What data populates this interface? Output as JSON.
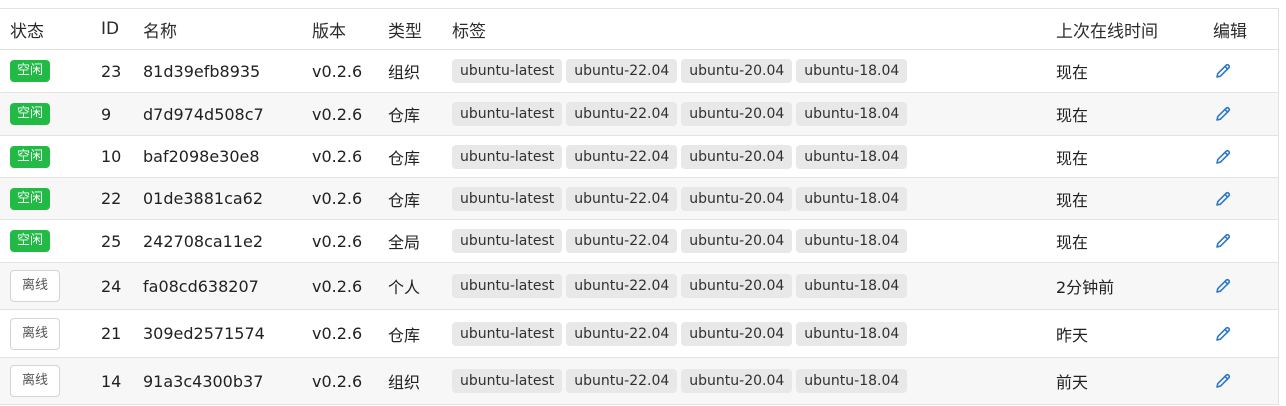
{
  "headers": {
    "status": "状态",
    "id": "ID",
    "name": "名称",
    "version": "版本",
    "type": "类型",
    "tags": "标签",
    "last_online": "上次在线时间",
    "edit": "编辑"
  },
  "colors": {
    "idle_badge": "#21ba45",
    "edit_icon": "#2f78c4"
  },
  "rows": [
    {
      "status": "空闲",
      "status_kind": "idle",
      "id": "23",
      "name": "81d39efb8935",
      "version": "v0.2.6",
      "type": "组织",
      "tags": [
        "ubuntu-latest",
        "ubuntu-22.04",
        "ubuntu-20.04",
        "ubuntu-18.04"
      ],
      "last_online": "现在",
      "edit_icon": "pencil-icon"
    },
    {
      "status": "空闲",
      "status_kind": "idle",
      "id": "9",
      "name": "d7d974d508c7",
      "version": "v0.2.6",
      "type": "仓库",
      "tags": [
        "ubuntu-latest",
        "ubuntu-22.04",
        "ubuntu-20.04",
        "ubuntu-18.04"
      ],
      "last_online": "现在",
      "edit_icon": "pencil-icon"
    },
    {
      "status": "空闲",
      "status_kind": "idle",
      "id": "10",
      "name": "baf2098e30e8",
      "version": "v0.2.6",
      "type": "仓库",
      "tags": [
        "ubuntu-latest",
        "ubuntu-22.04",
        "ubuntu-20.04",
        "ubuntu-18.04"
      ],
      "last_online": "现在",
      "edit_icon": "pencil-icon"
    },
    {
      "status": "空闲",
      "status_kind": "idle",
      "id": "22",
      "name": "01de3881ca62",
      "version": "v0.2.6",
      "type": "仓库",
      "tags": [
        "ubuntu-latest",
        "ubuntu-22.04",
        "ubuntu-20.04",
        "ubuntu-18.04"
      ],
      "last_online": "现在",
      "edit_icon": "pencil-icon"
    },
    {
      "status": "空闲",
      "status_kind": "idle",
      "id": "25",
      "name": "242708ca11e2",
      "version": "v0.2.6",
      "type": "全局",
      "tags": [
        "ubuntu-latest",
        "ubuntu-22.04",
        "ubuntu-20.04",
        "ubuntu-18.04"
      ],
      "last_online": "现在",
      "edit_icon": "pencil-icon"
    },
    {
      "status": "离线",
      "status_kind": "offline",
      "id": "24",
      "name": "fa08cd638207",
      "version": "v0.2.6",
      "type": "个人",
      "tags": [
        "ubuntu-latest",
        "ubuntu-22.04",
        "ubuntu-20.04",
        "ubuntu-18.04"
      ],
      "last_online": "2分钟前",
      "edit_icon": "pencil-icon"
    },
    {
      "status": "离线",
      "status_kind": "offline",
      "id": "21",
      "name": "309ed2571574",
      "version": "v0.2.6",
      "type": "仓库",
      "tags": [
        "ubuntu-latest",
        "ubuntu-22.04",
        "ubuntu-20.04",
        "ubuntu-18.04"
      ],
      "last_online": "昨天",
      "edit_icon": "pencil-icon"
    },
    {
      "status": "离线",
      "status_kind": "offline",
      "id": "14",
      "name": "91a3c4300b37",
      "version": "v0.2.6",
      "type": "组织",
      "tags": [
        "ubuntu-latest",
        "ubuntu-22.04",
        "ubuntu-20.04",
        "ubuntu-18.04"
      ],
      "last_online": "前天",
      "edit_icon": "pencil-icon"
    }
  ]
}
